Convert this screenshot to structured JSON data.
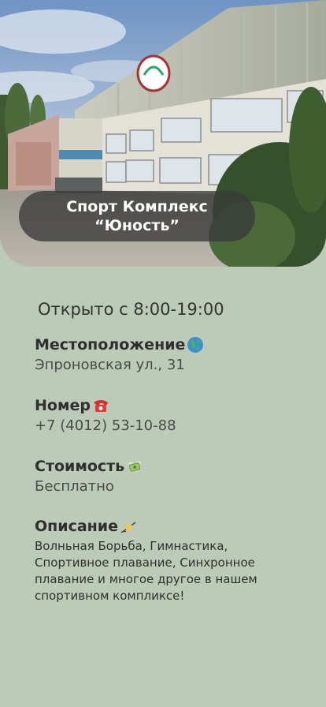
{
  "hero": {
    "title": "Спорт Комплекс\n“Юность”"
  },
  "hours": "Открыто с 8:00-19:00",
  "location": {
    "label": "Местоположение",
    "icon": "globe-icon",
    "value": "Эпроновская ул., 31"
  },
  "phone": {
    "label": "Номер",
    "icon": "telephone-icon",
    "value": "+7 (4012) 53-10-88"
  },
  "price": {
    "label": "Стоимость",
    "icon": "money-wings-icon",
    "value": "Бесплатно"
  },
  "description": {
    "label": "Описание",
    "icon": "writing-hand-icon",
    "value": "Волньная Борьба, Гимнастика, Спортивное плавание, Синхронное плавание и многое другое в нашем спортивном компликсе!"
  }
}
